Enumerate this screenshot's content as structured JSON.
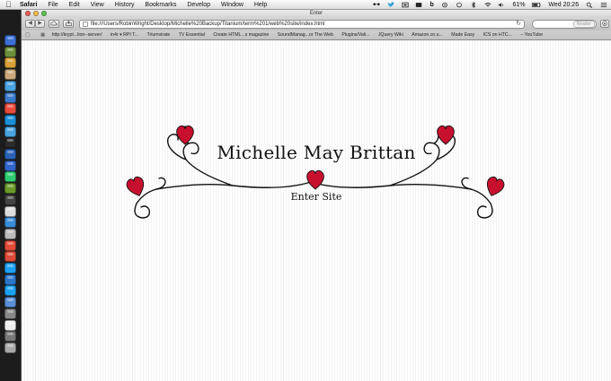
{
  "menubar": {
    "app_name": "Safari",
    "menus": [
      "File",
      "Edit",
      "View",
      "History",
      "Bookmarks",
      "Develop",
      "Window",
      "Help"
    ],
    "battery": "61%",
    "clock": "Wed 20:26"
  },
  "window": {
    "title": "Enter"
  },
  "toolbar": {
    "url": "file:///Users/RobinWright/Desktop/Michelle%20Backup/Titanium/term%201/web%20site/index.html",
    "reader_label": "Reader"
  },
  "bookmarks": [
    "http://krypt...lion--server/",
    "in4r ▾ RPI T...",
    "Triumvirate",
    "TV Essential",
    "Create HTML...s magazine",
    "SoundManag...or The Web",
    "Plugins/Vali...",
    "JQuery Wiki",
    "Amazon.co.u...",
    "Made Easy",
    "ICS on HTC...",
    "– YouTube"
  ],
  "page": {
    "site_title": "Michelle May Brittan",
    "enter_link": "Enter Site",
    "heart_color": "#c8102e",
    "line_color": "#111111"
  },
  "dock": {
    "icon_colors": [
      "#3b6fd6",
      "#6c8f3a",
      "#d8a037",
      "#c9a87b",
      "#4aa3df",
      "#3a78c9",
      "#e94b3c",
      "#1a8fd8",
      "#4aa3df",
      "#2b2b2b",
      "#2b62b5",
      "#3366cc",
      "#2ecc71",
      "#6a9a2c",
      "#444444",
      "#dddddd",
      "#3a8cd6",
      "#bbbbbb",
      "#e14b3b",
      "#dd4b39",
      "#1ea1f2",
      "#2b77c9",
      "#1da1f2",
      "#5a8fd6",
      "#888888",
      "#eeeeee",
      "#777777",
      "#aaaaaa"
    ]
  }
}
